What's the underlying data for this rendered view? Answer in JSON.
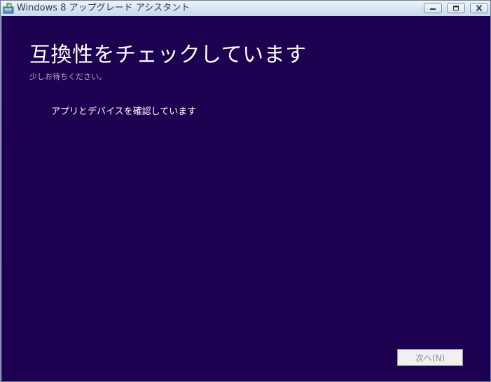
{
  "window": {
    "title": "Windows 8 アップグレード アシスタント",
    "icon": "windows-upgrade-icon"
  },
  "caption_buttons": {
    "minimize": "minimize-icon",
    "restore": "restore-icon",
    "close": "close-icon"
  },
  "main": {
    "heading": "互換性をチェックしています",
    "subtitle": "少しお待ちください。",
    "status": "アプリとデバイスを確認しています",
    "background_color": "#1b0150"
  },
  "footer": {
    "next_label": "次へ(N)",
    "next_enabled": false
  }
}
